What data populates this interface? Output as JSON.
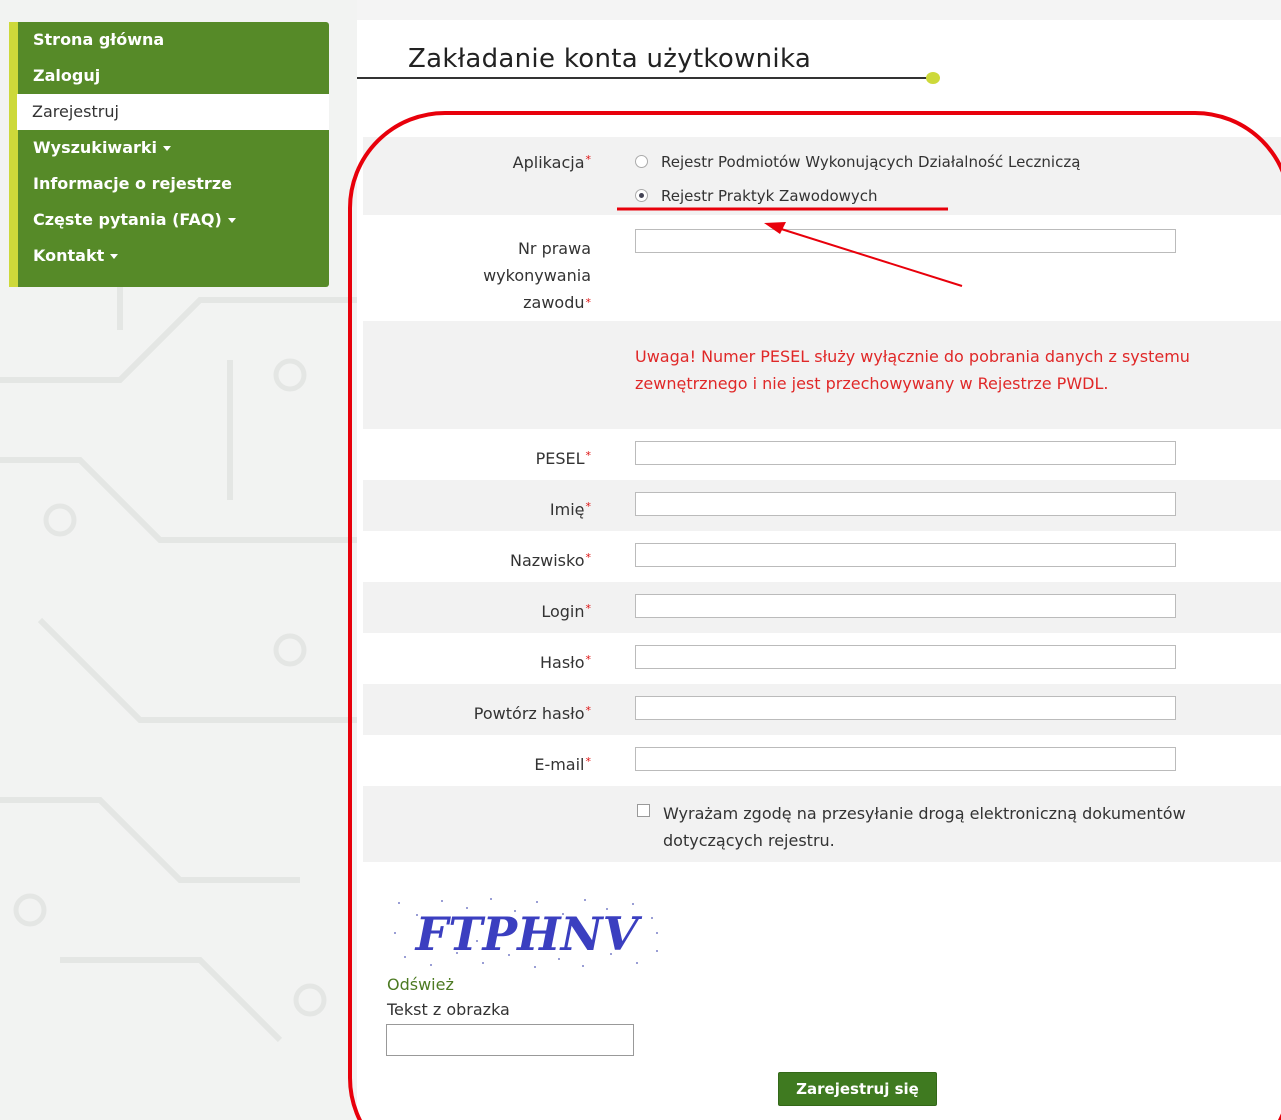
{
  "nav": {
    "items": [
      {
        "label": "Strona główna"
      },
      {
        "label": "Zaloguj"
      },
      {
        "label": "Zarejestruj"
      },
      {
        "label": "Wyszukiwarki"
      },
      {
        "label": "Informacje o rejestrze"
      },
      {
        "label": "Częste pytania (FAQ)"
      },
      {
        "label": "Kontakt"
      }
    ]
  },
  "page": {
    "title": "Zakładanie konta użytkownika"
  },
  "form": {
    "application": {
      "label": "Aplikacja",
      "options": [
        {
          "label": "Rejestr Podmiotów Wykonujących Działalność Leczniczą",
          "selected": false
        },
        {
          "label": "Rejestr Praktyk Zawodowych",
          "selected": true
        }
      ]
    },
    "license_number": {
      "label_1": "Nr prawa",
      "label_2": "wykonywania",
      "label_3": "zawodu",
      "value": ""
    },
    "warning": "Uwaga! Numer PESEL służy wyłącznie do pobrania danych z systemu zewnętrznego i nie jest przechowywany w Rejestrze PWDL.",
    "fields": {
      "pesel": {
        "label": "PESEL",
        "value": ""
      },
      "first_name": {
        "label": "Imię",
        "value": ""
      },
      "last_name": {
        "label": "Nazwisko",
        "value": ""
      },
      "login": {
        "label": "Login",
        "value": ""
      },
      "password": {
        "label": "Hasło",
        "value": ""
      },
      "password_repeat": {
        "label": "Powtórz hasło",
        "value": ""
      },
      "email": {
        "label": "E-mail",
        "value": ""
      }
    },
    "required_mark": "*",
    "consent": {
      "label": "Wyrażam zgodę na przesyłanie drogą elektroniczną dokumentów dotyczących rejestru.",
      "checked": false
    },
    "captcha": {
      "text": "FTPHNV",
      "refresh_label": "Odśwież",
      "input_label": "Tekst z obrazka",
      "value": ""
    },
    "submit_label": "Zarejestruj się"
  },
  "colors": {
    "nav_bg": "#568a28",
    "nav_accent": "#cdd93a",
    "warning": "#e02828",
    "annotation": "#e8000b",
    "submit_bg": "#3f7a20"
  }
}
